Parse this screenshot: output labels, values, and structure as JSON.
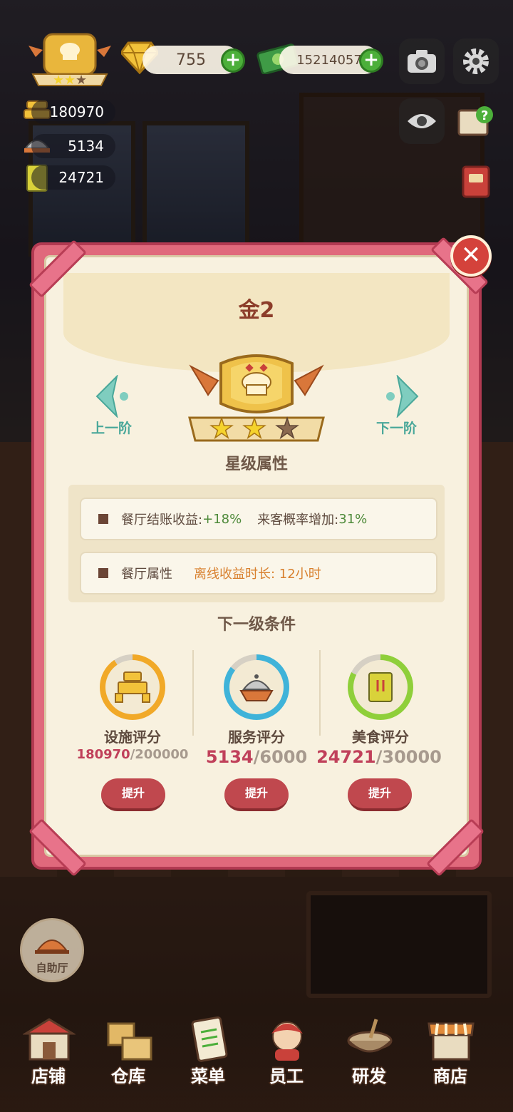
{
  "hud": {
    "gems": "755",
    "cash": "15214057",
    "facility_stat": "180970",
    "service_stat": "5134",
    "food_stat": "24721"
  },
  "dialog": {
    "title": "金2",
    "prev_label": "上一阶",
    "next_label": "下一阶",
    "stars_filled": 2,
    "stars_total": 3,
    "section_title": "星级属性",
    "attr1_label": "餐厅结账收益:",
    "attr1_value": "+18%",
    "attr2_label": "来客概率增加:",
    "attr2_value": "31%",
    "attr3_label": "餐厅属性",
    "attr3_value": "离线收益时长: 12小时",
    "next_section_title": "下一级条件",
    "categories": [
      {
        "label": "设施评分",
        "current": "180970",
        "target": "/200000",
        "progress": 0.905,
        "color": "#f1a928",
        "button": "提升"
      },
      {
        "label": "服务评分",
        "current": "5134",
        "target": "/6000",
        "progress": 0.856,
        "color": "#3fb3d9",
        "button": "提升"
      },
      {
        "label": "美食评分",
        "current": "24721",
        "target": "/30000",
        "progress": 0.824,
        "color": "#8fcf3a",
        "button": "提升"
      }
    ]
  },
  "buffet_label": "自助厅",
  "nav": [
    "店铺",
    "仓库",
    "菜单",
    "员工",
    "研发",
    "商店"
  ]
}
